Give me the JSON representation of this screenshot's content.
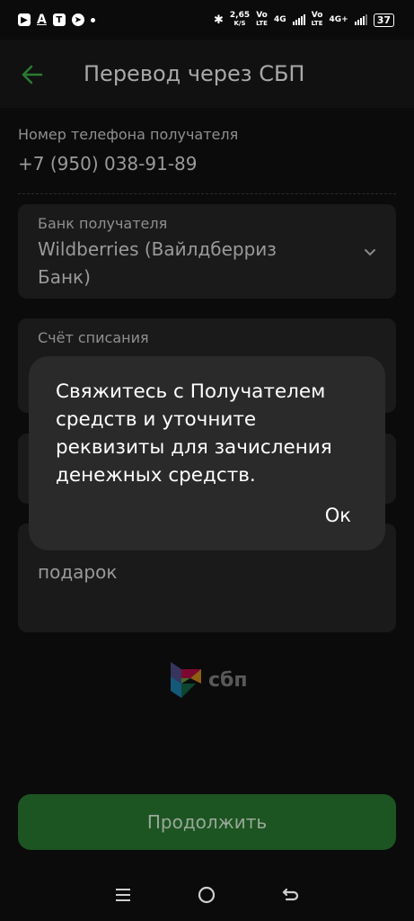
{
  "status_bar": {
    "net_speed": "2,65",
    "net_unit": "K/S",
    "sim1_vo": "Vo",
    "sim1_lte": "LTE",
    "sim1_gen": "4G",
    "sim2_vo": "Vo",
    "sim2_lte": "LTE",
    "sim2_gen": "4G+",
    "battery": "37"
  },
  "header": {
    "title": "Перевод через СБП"
  },
  "phone": {
    "label": "Номер телефона получателя",
    "value": "+7 (950) 038-91-89"
  },
  "bank": {
    "label": "Банк получателя",
    "value_line1": "Wildberries (Вайлдберриз",
    "value_line2": "Банк)"
  },
  "account": {
    "label": "Счёт списания"
  },
  "message": {
    "value": "подарок"
  },
  "sbp_logo_text": "сбп",
  "continue_label": "Продолжить",
  "dialog": {
    "line1": "Свяжитесь с Получателем",
    "line2": "средств и уточните",
    "line3": "реквизиты для зачисления",
    "line4": "денежных средств.",
    "ok_label": "Ок"
  },
  "colors": {
    "accent_green": "#1c5521",
    "arrow_green": "#2a7a31"
  },
  "icons": [
    "youtube-icon",
    "font-a-icon",
    "t-bank-icon",
    "telegram-icon",
    "bluetooth-icon",
    "back-arrow-icon",
    "chevron-down-icon",
    "sbp-logo-icon",
    "menu-icon",
    "home-icon",
    "back-icon"
  ]
}
